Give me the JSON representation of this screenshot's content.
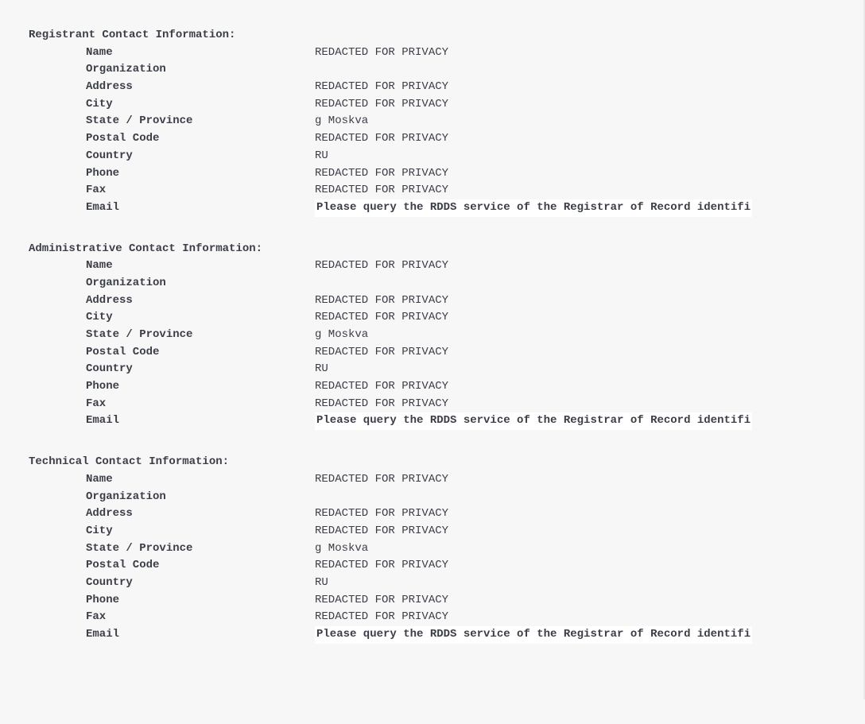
{
  "sections": [
    {
      "id": "registrant",
      "header": "Registrant Contact Information:",
      "rows": [
        {
          "label": "Name",
          "value": "REDACTED FOR PRIVACY",
          "bold": false
        },
        {
          "label": "Organization",
          "value": "",
          "bold": false
        },
        {
          "label": "Address",
          "value": "REDACTED FOR PRIVACY",
          "bold": false
        },
        {
          "label": "City",
          "value": "REDACTED FOR PRIVACY",
          "bold": false
        },
        {
          "label": "State / Province",
          "value": "g Moskva",
          "bold": false
        },
        {
          "label": "Postal Code",
          "value": "REDACTED FOR PRIVACY",
          "bold": false
        },
        {
          "label": "Country",
          "value": "RU",
          "bold": false
        },
        {
          "label": "Phone",
          "value": "REDACTED FOR PRIVACY",
          "bold": false
        },
        {
          "label": "Fax",
          "value": "REDACTED FOR PRIVACY",
          "bold": false
        },
        {
          "label": "Email",
          "value": "Please query the RDDS service of the Registrar of Record identifi",
          "bold": true
        }
      ]
    },
    {
      "id": "administrative",
      "header": "Administrative Contact Information:",
      "rows": [
        {
          "label": "Name",
          "value": "REDACTED FOR PRIVACY",
          "bold": false
        },
        {
          "label": "Organization",
          "value": "",
          "bold": false
        },
        {
          "label": "Address",
          "value": "REDACTED FOR PRIVACY",
          "bold": false
        },
        {
          "label": "City",
          "value": "REDACTED FOR PRIVACY",
          "bold": false
        },
        {
          "label": "State / Province",
          "value": "g Moskva",
          "bold": false
        },
        {
          "label": "Postal Code",
          "value": "REDACTED FOR PRIVACY",
          "bold": false
        },
        {
          "label": "Country",
          "value": "RU",
          "bold": false
        },
        {
          "label": "Phone",
          "value": "REDACTED FOR PRIVACY",
          "bold": false
        },
        {
          "label": "Fax",
          "value": "REDACTED FOR PRIVACY",
          "bold": false
        },
        {
          "label": "Email",
          "value": "Please query the RDDS service of the Registrar of Record identifi",
          "bold": true
        }
      ]
    },
    {
      "id": "technical",
      "header": "Technical Contact Information:",
      "rows": [
        {
          "label": "Name",
          "value": "REDACTED FOR PRIVACY",
          "bold": false
        },
        {
          "label": "Organization",
          "value": "",
          "bold": false
        },
        {
          "label": "Address",
          "value": "REDACTED FOR PRIVACY",
          "bold": false
        },
        {
          "label": "City",
          "value": "REDACTED FOR PRIVACY",
          "bold": false
        },
        {
          "label": "State / Province",
          "value": "g Moskva",
          "bold": false
        },
        {
          "label": "Postal Code",
          "value": "REDACTED FOR PRIVACY",
          "bold": false
        },
        {
          "label": "Country",
          "value": "RU",
          "bold": false
        },
        {
          "label": "Phone",
          "value": "REDACTED FOR PRIVACY",
          "bold": false
        },
        {
          "label": "Fax",
          "value": "REDACTED FOR PRIVACY",
          "bold": false
        },
        {
          "label": "Email",
          "value": "Please query the RDDS service of the Registrar of Record identifi",
          "bold": true
        }
      ]
    }
  ]
}
